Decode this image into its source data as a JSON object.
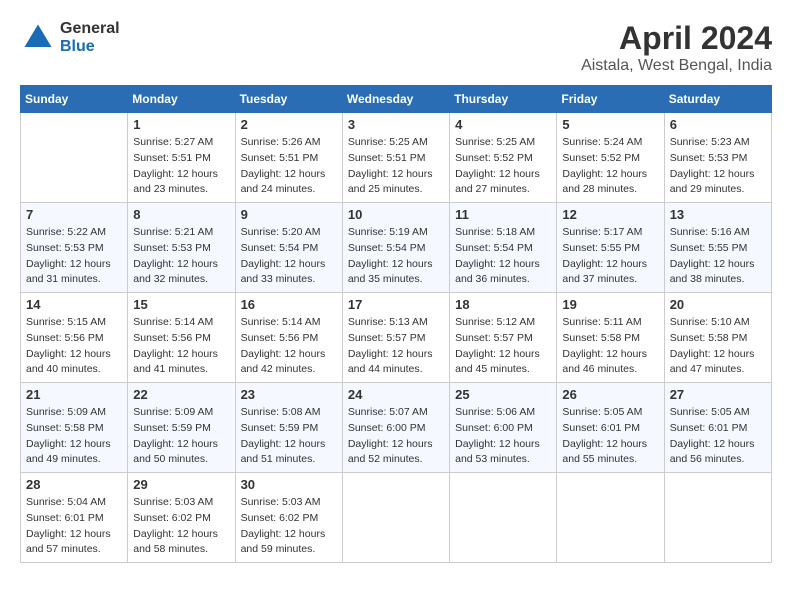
{
  "header": {
    "logo_line1": "General",
    "logo_line2": "Blue",
    "title": "April 2024",
    "location": "Aistala, West Bengal, India"
  },
  "calendar": {
    "columns": [
      "Sunday",
      "Monday",
      "Tuesday",
      "Wednesday",
      "Thursday",
      "Friday",
      "Saturday"
    ],
    "weeks": [
      [
        {
          "day": "",
          "sunrise": "",
          "sunset": "",
          "daylight": ""
        },
        {
          "day": "1",
          "sunrise": "Sunrise: 5:27 AM",
          "sunset": "Sunset: 5:51 PM",
          "daylight": "Daylight: 12 hours and 23 minutes."
        },
        {
          "day": "2",
          "sunrise": "Sunrise: 5:26 AM",
          "sunset": "Sunset: 5:51 PM",
          "daylight": "Daylight: 12 hours and 24 minutes."
        },
        {
          "day": "3",
          "sunrise": "Sunrise: 5:25 AM",
          "sunset": "Sunset: 5:51 PM",
          "daylight": "Daylight: 12 hours and 25 minutes."
        },
        {
          "day": "4",
          "sunrise": "Sunrise: 5:25 AM",
          "sunset": "Sunset: 5:52 PM",
          "daylight": "Daylight: 12 hours and 27 minutes."
        },
        {
          "day": "5",
          "sunrise": "Sunrise: 5:24 AM",
          "sunset": "Sunset: 5:52 PM",
          "daylight": "Daylight: 12 hours and 28 minutes."
        },
        {
          "day": "6",
          "sunrise": "Sunrise: 5:23 AM",
          "sunset": "Sunset: 5:53 PM",
          "daylight": "Daylight: 12 hours and 29 minutes."
        }
      ],
      [
        {
          "day": "7",
          "sunrise": "Sunrise: 5:22 AM",
          "sunset": "Sunset: 5:53 PM",
          "daylight": "Daylight: 12 hours and 31 minutes."
        },
        {
          "day": "8",
          "sunrise": "Sunrise: 5:21 AM",
          "sunset": "Sunset: 5:53 PM",
          "daylight": "Daylight: 12 hours and 32 minutes."
        },
        {
          "day": "9",
          "sunrise": "Sunrise: 5:20 AM",
          "sunset": "Sunset: 5:54 PM",
          "daylight": "Daylight: 12 hours and 33 minutes."
        },
        {
          "day": "10",
          "sunrise": "Sunrise: 5:19 AM",
          "sunset": "Sunset: 5:54 PM",
          "daylight": "Daylight: 12 hours and 35 minutes."
        },
        {
          "day": "11",
          "sunrise": "Sunrise: 5:18 AM",
          "sunset": "Sunset: 5:54 PM",
          "daylight": "Daylight: 12 hours and 36 minutes."
        },
        {
          "day": "12",
          "sunrise": "Sunrise: 5:17 AM",
          "sunset": "Sunset: 5:55 PM",
          "daylight": "Daylight: 12 hours and 37 minutes."
        },
        {
          "day": "13",
          "sunrise": "Sunrise: 5:16 AM",
          "sunset": "Sunset: 5:55 PM",
          "daylight": "Daylight: 12 hours and 38 minutes."
        }
      ],
      [
        {
          "day": "14",
          "sunrise": "Sunrise: 5:15 AM",
          "sunset": "Sunset: 5:56 PM",
          "daylight": "Daylight: 12 hours and 40 minutes."
        },
        {
          "day": "15",
          "sunrise": "Sunrise: 5:14 AM",
          "sunset": "Sunset: 5:56 PM",
          "daylight": "Daylight: 12 hours and 41 minutes."
        },
        {
          "day": "16",
          "sunrise": "Sunrise: 5:14 AM",
          "sunset": "Sunset: 5:56 PM",
          "daylight": "Daylight: 12 hours and 42 minutes."
        },
        {
          "day": "17",
          "sunrise": "Sunrise: 5:13 AM",
          "sunset": "Sunset: 5:57 PM",
          "daylight": "Daylight: 12 hours and 44 minutes."
        },
        {
          "day": "18",
          "sunrise": "Sunrise: 5:12 AM",
          "sunset": "Sunset: 5:57 PM",
          "daylight": "Daylight: 12 hours and 45 minutes."
        },
        {
          "day": "19",
          "sunrise": "Sunrise: 5:11 AM",
          "sunset": "Sunset: 5:58 PM",
          "daylight": "Daylight: 12 hours and 46 minutes."
        },
        {
          "day": "20",
          "sunrise": "Sunrise: 5:10 AM",
          "sunset": "Sunset: 5:58 PM",
          "daylight": "Daylight: 12 hours and 47 minutes."
        }
      ],
      [
        {
          "day": "21",
          "sunrise": "Sunrise: 5:09 AM",
          "sunset": "Sunset: 5:58 PM",
          "daylight": "Daylight: 12 hours and 49 minutes."
        },
        {
          "day": "22",
          "sunrise": "Sunrise: 5:09 AM",
          "sunset": "Sunset: 5:59 PM",
          "daylight": "Daylight: 12 hours and 50 minutes."
        },
        {
          "day": "23",
          "sunrise": "Sunrise: 5:08 AM",
          "sunset": "Sunset: 5:59 PM",
          "daylight": "Daylight: 12 hours and 51 minutes."
        },
        {
          "day": "24",
          "sunrise": "Sunrise: 5:07 AM",
          "sunset": "Sunset: 6:00 PM",
          "daylight": "Daylight: 12 hours and 52 minutes."
        },
        {
          "day": "25",
          "sunrise": "Sunrise: 5:06 AM",
          "sunset": "Sunset: 6:00 PM",
          "daylight": "Daylight: 12 hours and 53 minutes."
        },
        {
          "day": "26",
          "sunrise": "Sunrise: 5:05 AM",
          "sunset": "Sunset: 6:01 PM",
          "daylight": "Daylight: 12 hours and 55 minutes."
        },
        {
          "day": "27",
          "sunrise": "Sunrise: 5:05 AM",
          "sunset": "Sunset: 6:01 PM",
          "daylight": "Daylight: 12 hours and 56 minutes."
        }
      ],
      [
        {
          "day": "28",
          "sunrise": "Sunrise: 5:04 AM",
          "sunset": "Sunset: 6:01 PM",
          "daylight": "Daylight: 12 hours and 57 minutes."
        },
        {
          "day": "29",
          "sunrise": "Sunrise: 5:03 AM",
          "sunset": "Sunset: 6:02 PM",
          "daylight": "Daylight: 12 hours and 58 minutes."
        },
        {
          "day": "30",
          "sunrise": "Sunrise: 5:03 AM",
          "sunset": "Sunset: 6:02 PM",
          "daylight": "Daylight: 12 hours and 59 minutes."
        },
        {
          "day": "",
          "sunrise": "",
          "sunset": "",
          "daylight": ""
        },
        {
          "day": "",
          "sunrise": "",
          "sunset": "",
          "daylight": ""
        },
        {
          "day": "",
          "sunrise": "",
          "sunset": "",
          "daylight": ""
        },
        {
          "day": "",
          "sunrise": "",
          "sunset": "",
          "daylight": ""
        }
      ]
    ]
  }
}
